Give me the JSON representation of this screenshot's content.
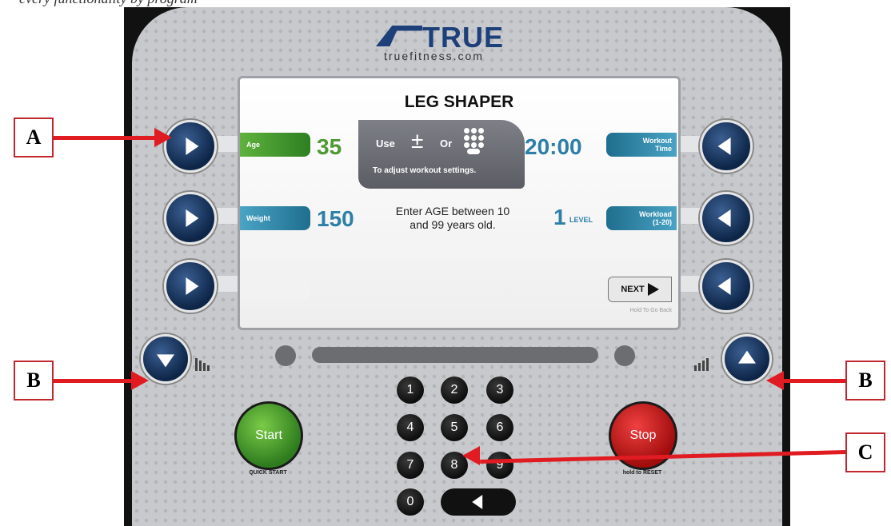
{
  "top_caption": "every functionality by program",
  "brand": {
    "name": "TRUE",
    "url": "truefitness.com"
  },
  "screen": {
    "title": "LEG SHAPER",
    "age": {
      "label": "Age",
      "value": "35"
    },
    "weight": {
      "label": "Weight",
      "value": "150"
    },
    "workout_time": {
      "label": "Workout Time",
      "value": "20:00"
    },
    "workload": {
      "label": "Workload (1-20)",
      "value": "1",
      "unit": "LEVEL"
    },
    "help": {
      "use": "Use",
      "plus_minus": "±",
      "or": "Or",
      "hint": "To adjust workout settings."
    },
    "prompt": "Enter AGE between 10 and 99 years old.",
    "next_label": "NEXT",
    "hold_back": "Hold To Go Back"
  },
  "keypad": {
    "keys": [
      "1",
      "2",
      "3",
      "4",
      "5",
      "6",
      "7",
      "8",
      "9",
      "0"
    ]
  },
  "start": {
    "label": "Start",
    "sub": "QUICK START",
    "color": "#3f9a2a"
  },
  "stop": {
    "label": "Stop",
    "sub": "hold to RESET",
    "color": "#c4161c"
  },
  "callouts": {
    "a": "A",
    "b_left": "B",
    "b_right": "B",
    "c": "C"
  },
  "annotation_color": "#e11b22",
  "icons": [
    "play-right-icon",
    "play-left-icon",
    "down-arrow-icon",
    "up-arrow-icon",
    "incline-bars-icon",
    "decline-bars-icon",
    "back-arrow-icon"
  ]
}
